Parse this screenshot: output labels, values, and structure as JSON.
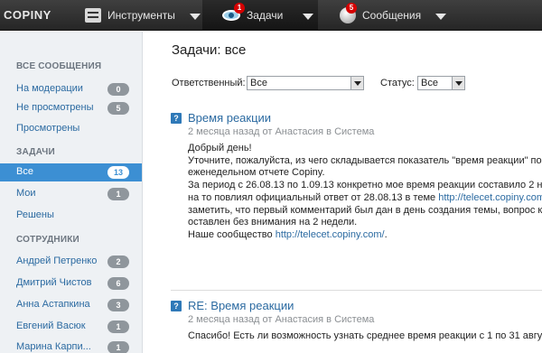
{
  "app": {
    "logo": "COPINY"
  },
  "topnav": [
    {
      "label": "Инструменты"
    },
    {
      "label": "Задачи",
      "badge": "1"
    },
    {
      "label": "Сообщения",
      "badge": "5"
    }
  ],
  "sidebar": {
    "sections": [
      {
        "title": "ВСЕ СООБЩЕНИЯ",
        "items": [
          {
            "label": "На модерации",
            "count": "0"
          },
          {
            "label": "Не просмотрены",
            "count": "5"
          },
          {
            "label": "Просмотрены"
          }
        ]
      },
      {
        "title": "ЗАДАЧИ",
        "items": [
          {
            "label": "Все",
            "count": "13"
          },
          {
            "label": "Мои",
            "count": "1"
          },
          {
            "label": "Решены"
          }
        ]
      },
      {
        "title": "СОТРУДНИКИ",
        "items": [
          {
            "label": "Андрей Петренко",
            "count": "2"
          },
          {
            "label": "Дмитрий Чистов",
            "count": "6"
          },
          {
            "label": "Анна Астапкина",
            "count": "3"
          },
          {
            "label": "Евгений Васюк",
            "count": "1"
          },
          {
            "label": "Марина Карпи...",
            "count": "1"
          }
        ]
      }
    ]
  },
  "main": {
    "title": "Задачи: все",
    "filters": {
      "responsible_label": "Ответственный:",
      "responsible_value": "Все",
      "status_label": "Статус:",
      "status_value": "Все"
    },
    "topics": [
      {
        "icon": "?",
        "title": "Время реакции",
        "meta": "2 месяца назад от Анастасия в Система",
        "lines": [
          "Добрый день!",
          "Уточните, пожалуйста, из чего складывается показатель \"время реакции\" по",
          "еженедельном отчете Copiny.",
          "За период с 26.08.13 по 1.09.13 конкретно мое время реакции составило 2 н",
          "на то повлиял официальный ответ от 28.08.13 в теме ",
          "заметить, что первый комментарий был дан в день создания темы, вопрос к",
          "оставлен без внимания на 2 недели.",
          "Наше сообщество "
        ],
        "link1": "http://telecet.copiny.com",
        "link2": "http://telecet.copiny.com/",
        "link2_suffix": "."
      },
      {
        "icon": "?",
        "title": "RE: Время реакции",
        "meta": "2 месяца назад от Анастасия в Система",
        "lines": [
          "Спасибо! Есть ли возможность узнать среднее время реакции с 1 по 31 авгу"
        ]
      }
    ]
  }
}
